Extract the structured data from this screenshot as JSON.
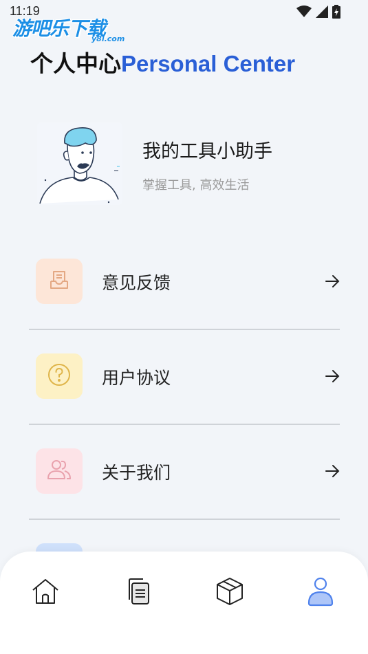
{
  "status_bar": {
    "time": "11:19",
    "icons": [
      "wifi-icon",
      "signal-icon",
      "battery-icon"
    ]
  },
  "watermark": {
    "text": "游吧乐下载",
    "sub": "y8l.com"
  },
  "header": {
    "title_cn": "个人中心",
    "title_en": "Personal Center"
  },
  "profile": {
    "name": "我的工具小助手",
    "subtitle": "掌握工具, 高效生活"
  },
  "menu": {
    "items": [
      {
        "label": "意见反馈",
        "icon": "inbox-icon",
        "bg": "#fde6d8",
        "stroke": "#e4a883"
      },
      {
        "label": "用户协议",
        "icon": "question-icon",
        "bg": "#fdf1c5",
        "stroke": "#dfb54a"
      },
      {
        "label": "关于我们",
        "icon": "users-icon",
        "bg": "#fde3e7",
        "stroke": "#e9a2ad"
      }
    ]
  },
  "bottom_nav": {
    "items": [
      {
        "name": "home",
        "icon": "home-icon",
        "active": false
      },
      {
        "name": "documents",
        "icon": "documents-icon",
        "active": false
      },
      {
        "name": "tools",
        "icon": "box-icon",
        "active": false
      },
      {
        "name": "profile",
        "icon": "user-icon",
        "active": true
      }
    ]
  },
  "colors": {
    "accent": "#2a5fd6",
    "active_nav": "#5b8ef0",
    "background": "#f2f5f9"
  }
}
